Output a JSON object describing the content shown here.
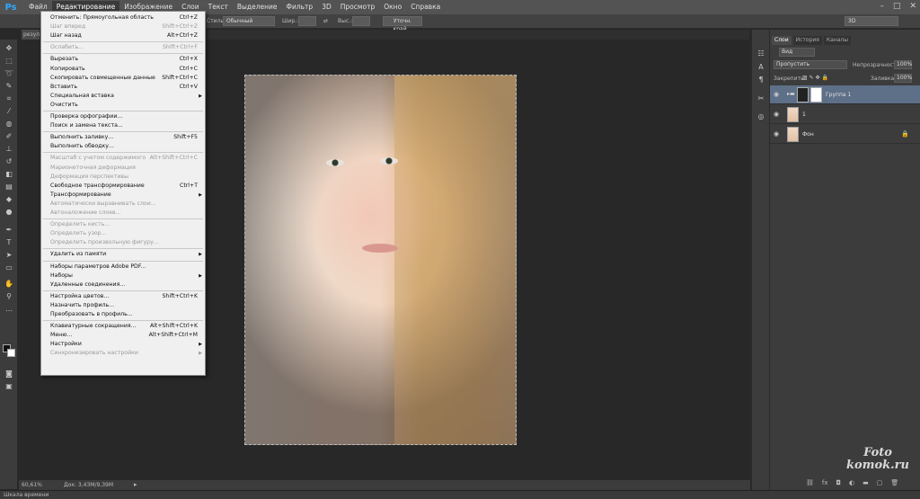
{
  "app_logo": "Ps",
  "menubar": [
    "Файл",
    "Редактирование",
    "Изображение",
    "Слои",
    "Текст",
    "Выделение",
    "Фильтр",
    "3D",
    "Просмотр",
    "Окно",
    "Справка"
  ],
  "options": {
    "style_label": "Стиль:",
    "style_value": "Обычный",
    "width_label": "Шир.:",
    "height_label": "Выс.:",
    "refine_button": "Уточн. край...",
    "workspace": "3D"
  },
  "doc_tab": "результат",
  "status": {
    "zoom": "60,61%",
    "doc": "Док: 3,43M/9,39M"
  },
  "timeline": "Шкала времени",
  "edit_menu": [
    {
      "label": "Отменить: Прямоугольная область",
      "shortcut": "Ctrl+Z",
      "disabled": false
    },
    {
      "label": "Шаг вперед",
      "shortcut": "Shift+Ctrl+Z",
      "disabled": true
    },
    {
      "label": "Шаг назад",
      "shortcut": "Alt+Ctrl+Z",
      "disabled": false
    },
    {
      "sep": true
    },
    {
      "label": "Ослабить...",
      "shortcut": "Shift+Ctrl+F",
      "disabled": true
    },
    {
      "sep": true
    },
    {
      "label": "Вырезать",
      "shortcut": "Ctrl+X",
      "disabled": false
    },
    {
      "label": "Копировать",
      "shortcut": "Ctrl+C",
      "disabled": false
    },
    {
      "label": "Скопировать совмещенные данные",
      "shortcut": "Shift+Ctrl+C",
      "disabled": false
    },
    {
      "label": "Вставить",
      "shortcut": "Ctrl+V",
      "disabled": false
    },
    {
      "label": "Специальная вставка",
      "shortcut": "",
      "disabled": false,
      "submenu": true
    },
    {
      "label": "Очистить",
      "shortcut": "",
      "disabled": false
    },
    {
      "sep": true
    },
    {
      "label": "Проверка орфографии...",
      "shortcut": "",
      "disabled": false
    },
    {
      "label": "Поиск и замена текста...",
      "shortcut": "",
      "disabled": false
    },
    {
      "sep": true
    },
    {
      "label": "Выполнить заливку...",
      "shortcut": "Shift+F5",
      "disabled": false
    },
    {
      "label": "Выполнить обводку...",
      "shortcut": "",
      "disabled": false
    },
    {
      "sep": true
    },
    {
      "label": "Масштаб с учетом содержимого",
      "shortcut": "Alt+Shift+Ctrl+C",
      "disabled": true
    },
    {
      "label": "Марионеточная деформация",
      "shortcut": "",
      "disabled": true
    },
    {
      "label": "Деформация перспективы",
      "shortcut": "",
      "disabled": true
    },
    {
      "label": "Свободное трансформирование",
      "shortcut": "Ctrl+T",
      "disabled": false
    },
    {
      "label": "Трансформирование",
      "shortcut": "",
      "disabled": false,
      "submenu": true
    },
    {
      "label": "Автоматически выравнивать слои...",
      "shortcut": "",
      "disabled": true
    },
    {
      "label": "Автоналожение слоев...",
      "shortcut": "",
      "disabled": true
    },
    {
      "sep": true
    },
    {
      "label": "Определить кисть...",
      "shortcut": "",
      "disabled": true
    },
    {
      "label": "Определить узор...",
      "shortcut": "",
      "disabled": true
    },
    {
      "label": "Определить произвольную фигуру...",
      "shortcut": "",
      "disabled": true
    },
    {
      "sep": true
    },
    {
      "label": "Удалить из памяти",
      "shortcut": "",
      "disabled": false,
      "submenu": true
    },
    {
      "sep": true
    },
    {
      "label": "Наборы параметров Adobe PDF...",
      "shortcut": "",
      "disabled": false
    },
    {
      "label": "Наборы",
      "shortcut": "",
      "disabled": false,
      "submenu": true
    },
    {
      "label": "Удаленные соединения...",
      "shortcut": "",
      "disabled": false
    },
    {
      "sep": true
    },
    {
      "label": "Настройка цветов...",
      "shortcut": "Shift+Ctrl+K",
      "disabled": false
    },
    {
      "label": "Назначить профиль...",
      "shortcut": "",
      "disabled": false
    },
    {
      "label": "Преобразовать в профиль...",
      "shortcut": "",
      "disabled": false
    },
    {
      "sep": true
    },
    {
      "label": "Клавиатурные сокращения...",
      "shortcut": "Alt+Shift+Ctrl+K",
      "disabled": false
    },
    {
      "label": "Меню...",
      "shortcut": "Alt+Shift+Ctrl+M",
      "disabled": false
    },
    {
      "label": "Настройки",
      "shortcut": "",
      "disabled": false,
      "submenu": true
    },
    {
      "label": "Синхронизировать настройки",
      "shortcut": "",
      "disabled": true,
      "submenu": true
    }
  ],
  "layers_panel": {
    "tabs": [
      "Слои",
      "История",
      "Каналы"
    ],
    "kind": "Вид",
    "blend_mode": "Пропустить",
    "opacity_label": "Непрозрачность:",
    "opacity": "100%",
    "lock_label": "Закрепить:",
    "fill_label": "Заливка:",
    "fill": "100%",
    "layers": [
      {
        "name": "Группа 1",
        "selected": true,
        "type": "group"
      },
      {
        "name": "1",
        "selected": false,
        "type": "layer"
      },
      {
        "name": "Фон",
        "selected": false,
        "type": "background"
      }
    ]
  },
  "watermark": [
    "Foto",
    "komok.ru"
  ]
}
